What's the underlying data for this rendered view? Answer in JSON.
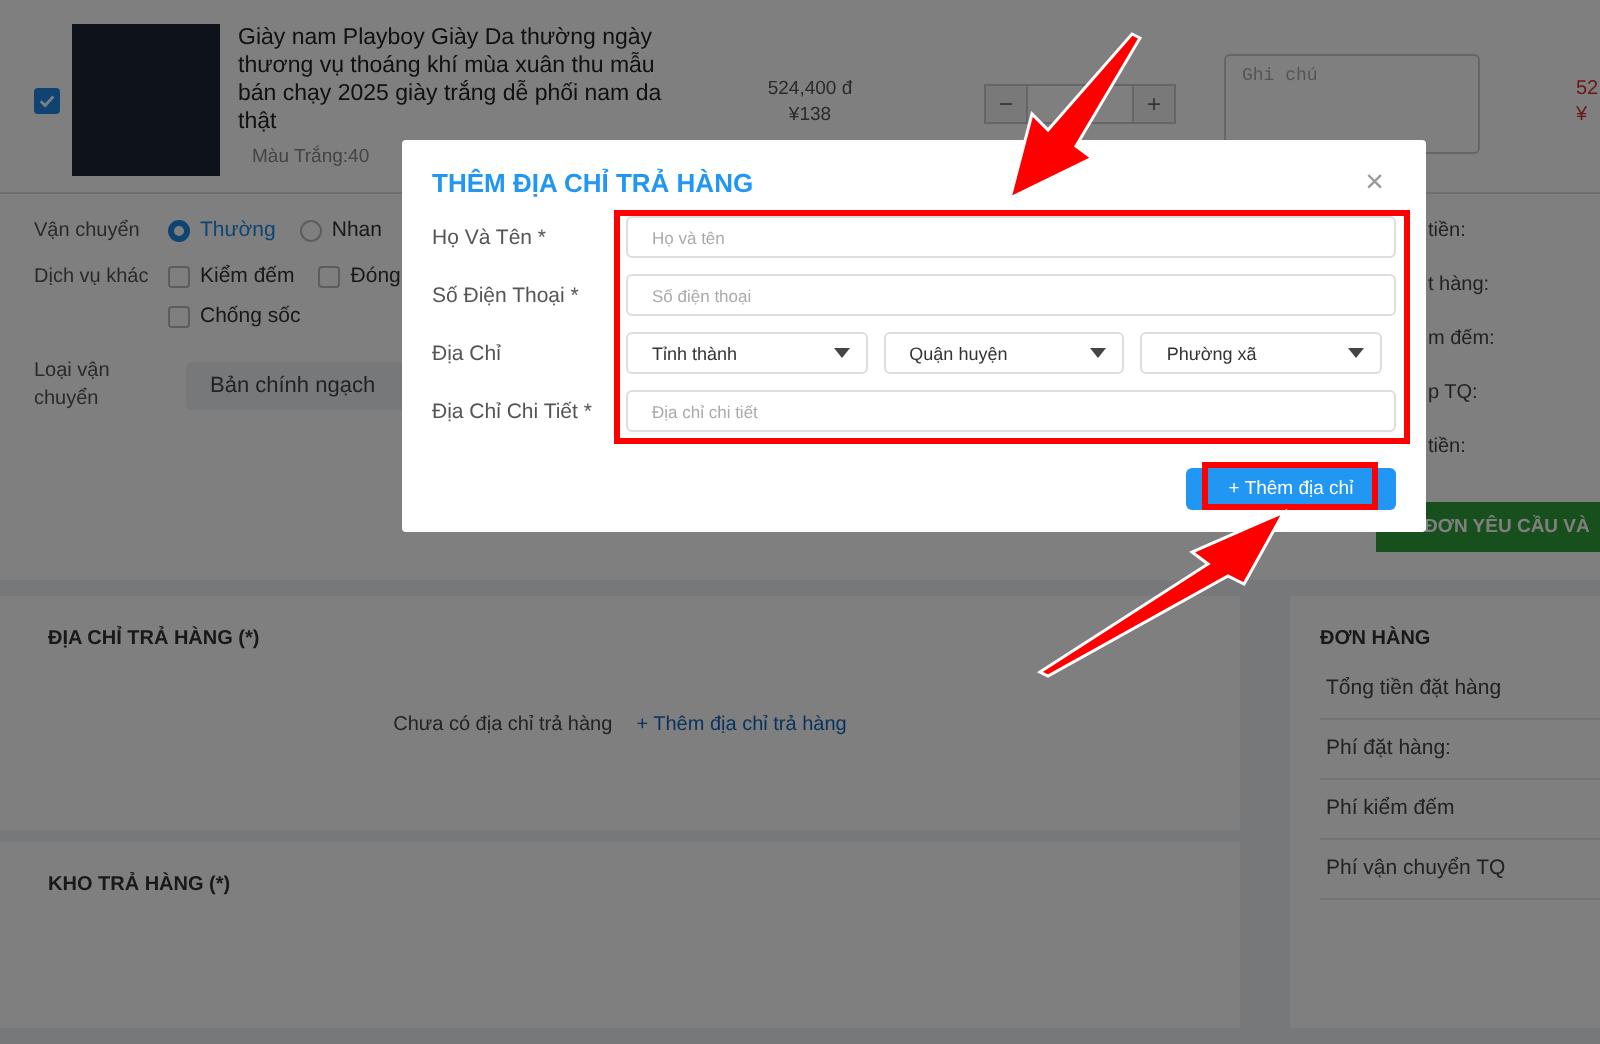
{
  "product": {
    "checked": true,
    "title": "Giày nam Playboy Giày Da thường ngày thương vụ thoáng khí mùa xuân thu mẫu bán chạy 2025 giày trắng dễ phối nam da thật",
    "variant": "Màu Trắng:40",
    "price_vnd": "524,400 đ",
    "price_cny": "¥138",
    "stepper": {
      "minus": "−",
      "plus": "+"
    },
    "note_placeholder": "Ghi chú",
    "total_vnd": "52",
    "total_cny": "¥"
  },
  "options": {
    "shipping": {
      "label": "Vận chuyển",
      "choices": [
        {
          "label": "Thường",
          "selected": true
        },
        {
          "label": "Nhan",
          "selected": false
        }
      ]
    },
    "services": {
      "label": "Dịch vụ khác",
      "items": [
        {
          "label": "Kiểm đếm",
          "checked": false
        },
        {
          "label": "Đóng",
          "checked": false
        },
        {
          "label": "Chống sốc",
          "checked": false
        }
      ]
    },
    "transport_type": {
      "label": "Loại vận chuyển",
      "value": "Bản chính ngạch"
    }
  },
  "summary_top": {
    "rows": [
      "tiền:",
      "t hàng:",
      "m đếm:",
      "p TQ:",
      "tiền:"
    ],
    "button": "ĐƠN YÊU CẦU VÀ"
  },
  "return_address": {
    "title": "ĐỊA CHỈ TRẢ HÀNG (*)",
    "empty_text": "Chưa có địa chỉ trả hàng",
    "add_link": "+ Thêm địa chỉ trả hàng"
  },
  "return_warehouse": {
    "title": "KHO TRẢ HÀNG (*)"
  },
  "order": {
    "title": "ĐƠN HÀNG",
    "rows": [
      "Tổng tiền đặt hàng",
      "Phí đặt hàng:",
      "Phí kiểm đếm",
      "Phí vận chuyển TQ"
    ]
  },
  "modal": {
    "title": "THÊM ĐỊA CHỈ TRẢ HÀNG",
    "close": "×",
    "fields": [
      {
        "kind": "input",
        "label": "Họ Và Tên *",
        "placeholder": "Họ và tên"
      },
      {
        "kind": "input",
        "label": "Số Điện Thoại *",
        "placeholder": "Số điện thoại"
      },
      {
        "kind": "selects",
        "label": "Địa Chỉ",
        "options": [
          "Tỉnh thành",
          "Quận huyện",
          "Phường xã"
        ]
      },
      {
        "kind": "input",
        "label": "Địa Chỉ Chi Tiết *",
        "placeholder": "Địa chỉ chi tiết"
      }
    ],
    "submit": "+ Thêm địa chỉ"
  }
}
